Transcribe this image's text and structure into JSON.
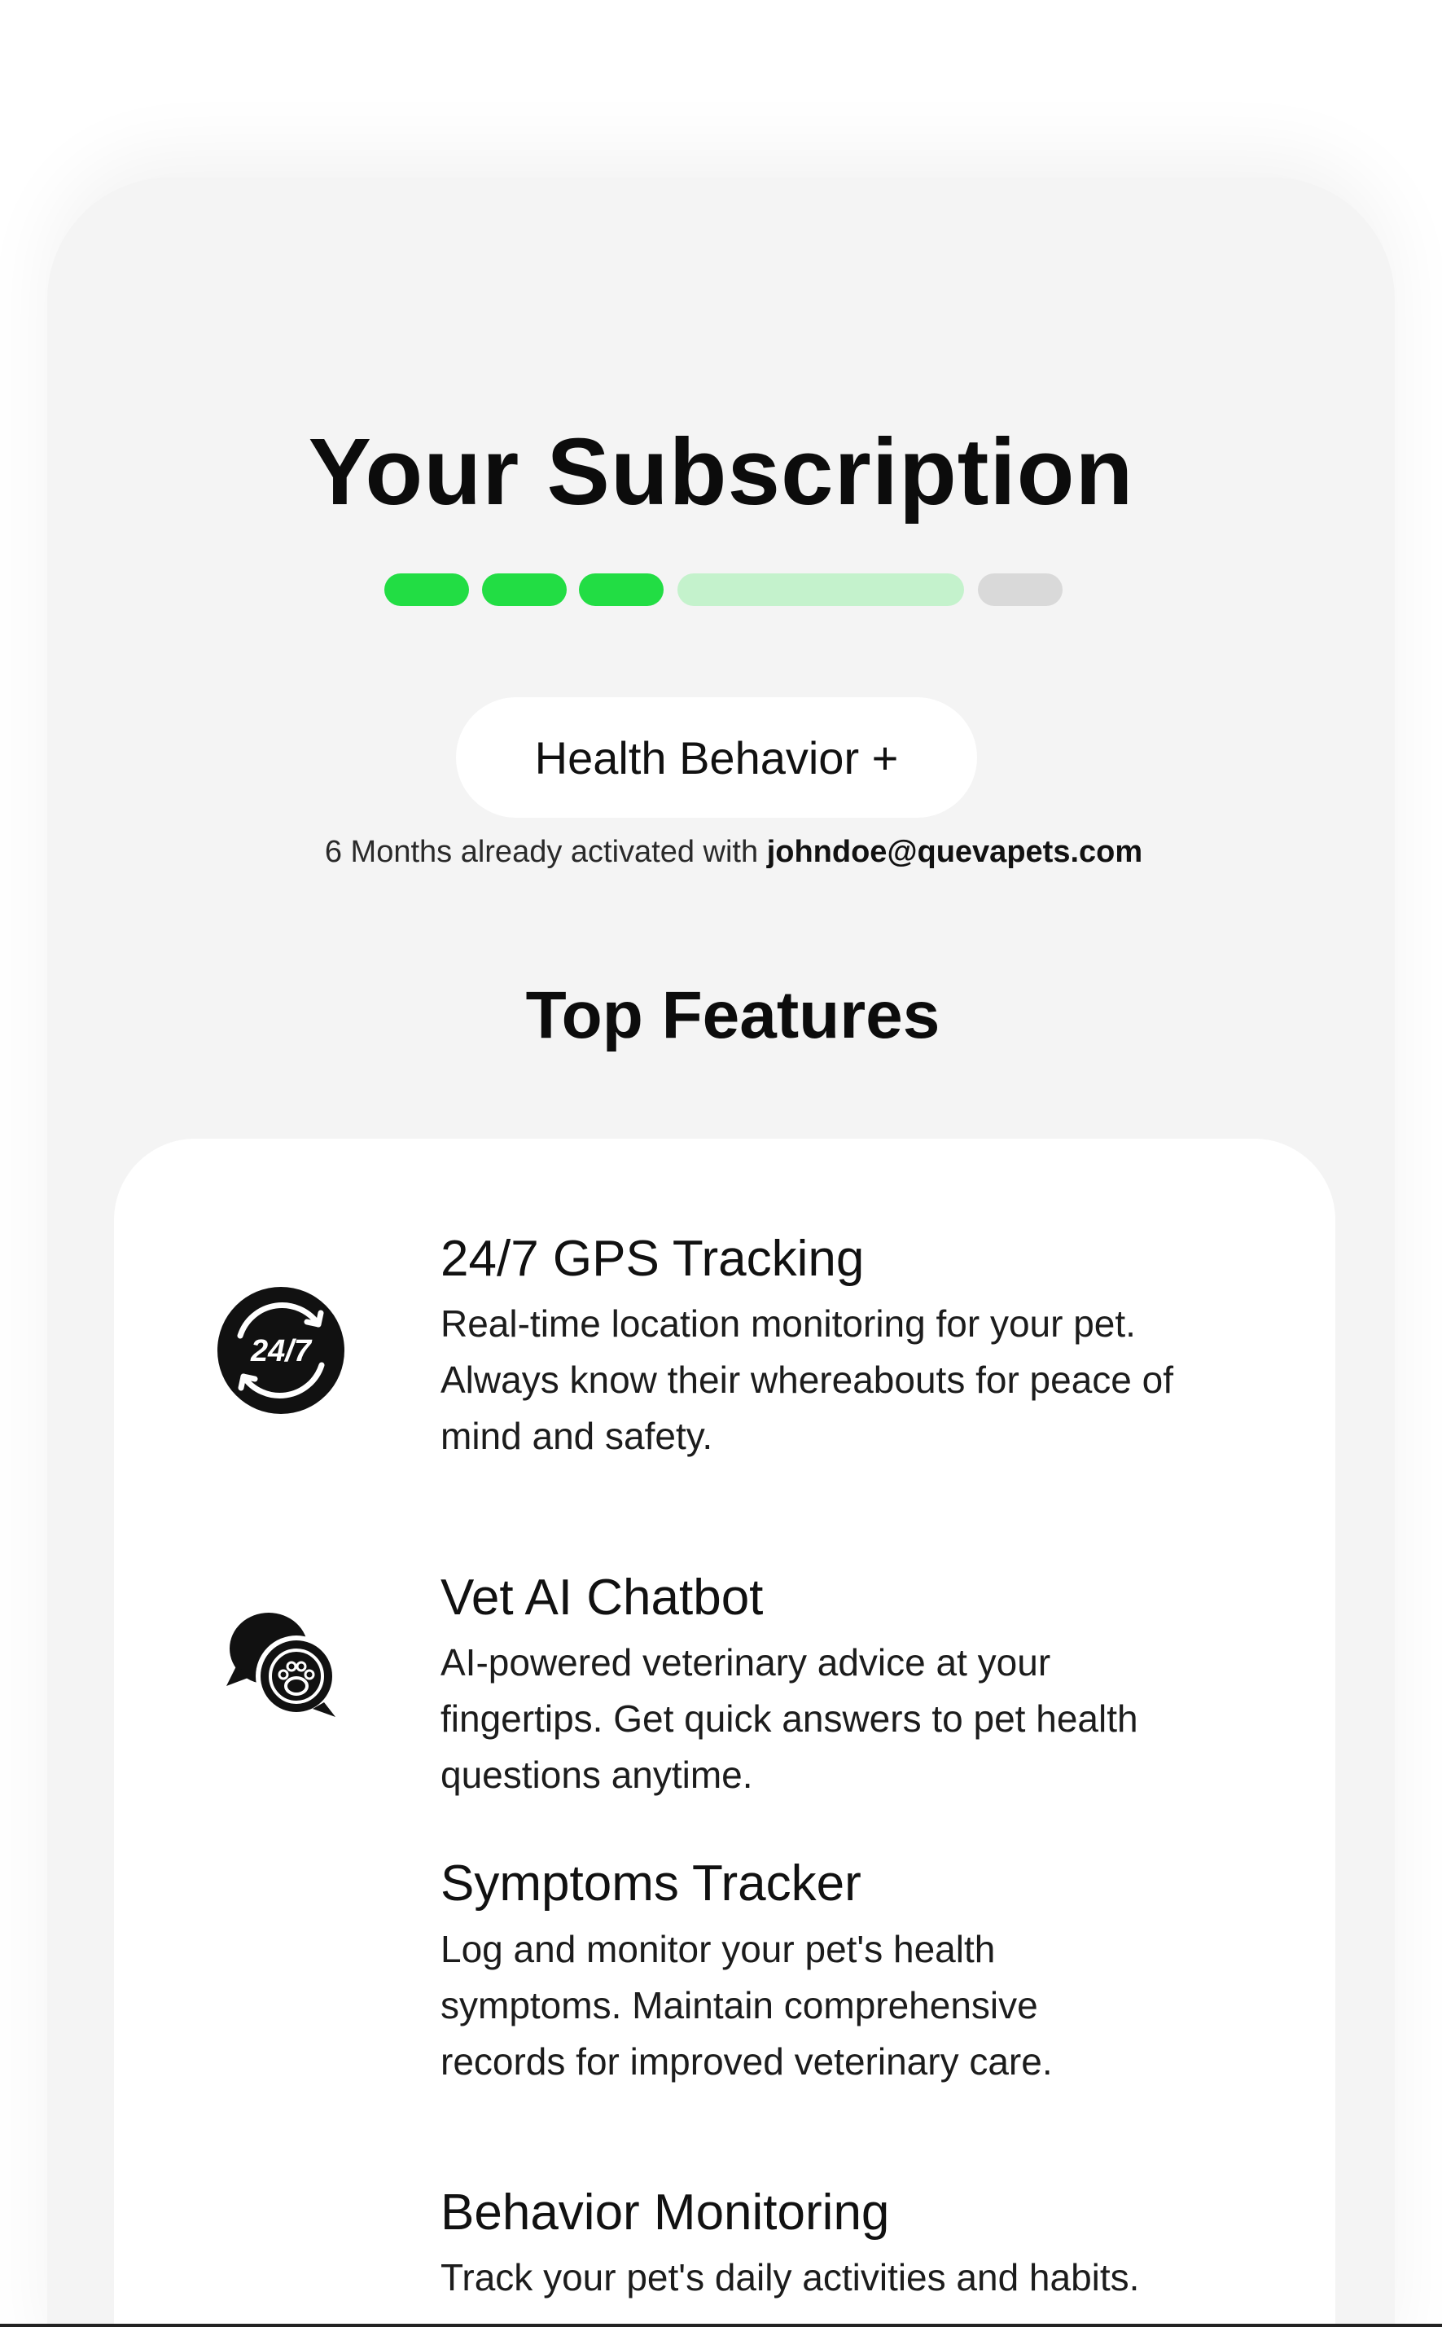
{
  "page": {
    "title": "Your Subscription",
    "plan_label": "Health Behavior +",
    "activation_prefix": "6 Months already activated with ",
    "activation_email": "johndoe@quevapets.com",
    "features_heading": "Top Features"
  },
  "progress": {
    "segments": [
      {
        "state": "complete",
        "color": "#22dd44"
      },
      {
        "state": "complete",
        "color": "#22dd44"
      },
      {
        "state": "complete",
        "color": "#22dd44"
      },
      {
        "state": "current",
        "color": "#c4f2cc"
      },
      {
        "state": "upcoming",
        "color": "#d9d9d9"
      }
    ]
  },
  "features": [
    {
      "title": "24/7 GPS Tracking",
      "icon": "clock-24-7-icon",
      "icon_text": "24/7",
      "lines": [
        "Real-time location monitoring for your pet.",
        "Always know their whereabouts for peace of",
        "mind and safety."
      ]
    },
    {
      "title": "Vet AI Chatbot",
      "icon": "chat-paw-icon",
      "lines": [
        "AI-powered veterinary advice at your",
        "fingertips. Get quick answers to pet health",
        "questions anytime."
      ]
    },
    {
      "title": "Symptoms Tracker",
      "icon": "",
      "lines": [
        "Log and monitor your pet's health",
        "symptoms. Maintain comprehensive",
        "records for improved veterinary care."
      ]
    },
    {
      "title": "Behavior Monitoring",
      "icon": "",
      "lines": [
        "Track your pet's daily activities and habits."
      ]
    }
  ]
}
